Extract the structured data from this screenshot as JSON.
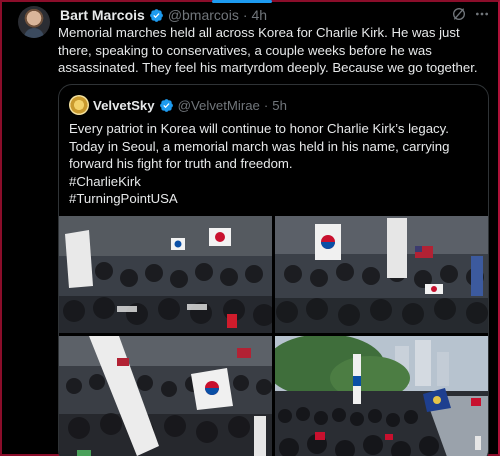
{
  "post": {
    "author_name": "Bart Marcois",
    "author_handle": "@bmarcois",
    "separator": "·",
    "time": "4h",
    "text": "Memorial marches held all across Korea for Charlie Kirk. He was just there, speaking to conservatives, a couple weeks before he was assassinated. They feel his martyrdom deeply. Because we go together."
  },
  "quote": {
    "author_name": "VelvetSky",
    "author_handle": "@VelvetMirae",
    "separator": "·",
    "time": "5h",
    "text": "Every patriot in Korea will continue to honor Charlie Kirk’s legacy. Today in Seoul, a memorial march was held in his name, carrying forward his fight for truth and freedom.\n#CharlieKirk\n#TurningPointUSA"
  },
  "colors": {
    "background": "#000000",
    "text": "#e7e9ea",
    "secondary_text": "#71767b",
    "verified": "#1d9bf0",
    "border": "#2f3336",
    "frame": "#8b0d2a"
  },
  "icons": [
    "verified-badge-icon",
    "grok-icon",
    "more-options-icon"
  ]
}
